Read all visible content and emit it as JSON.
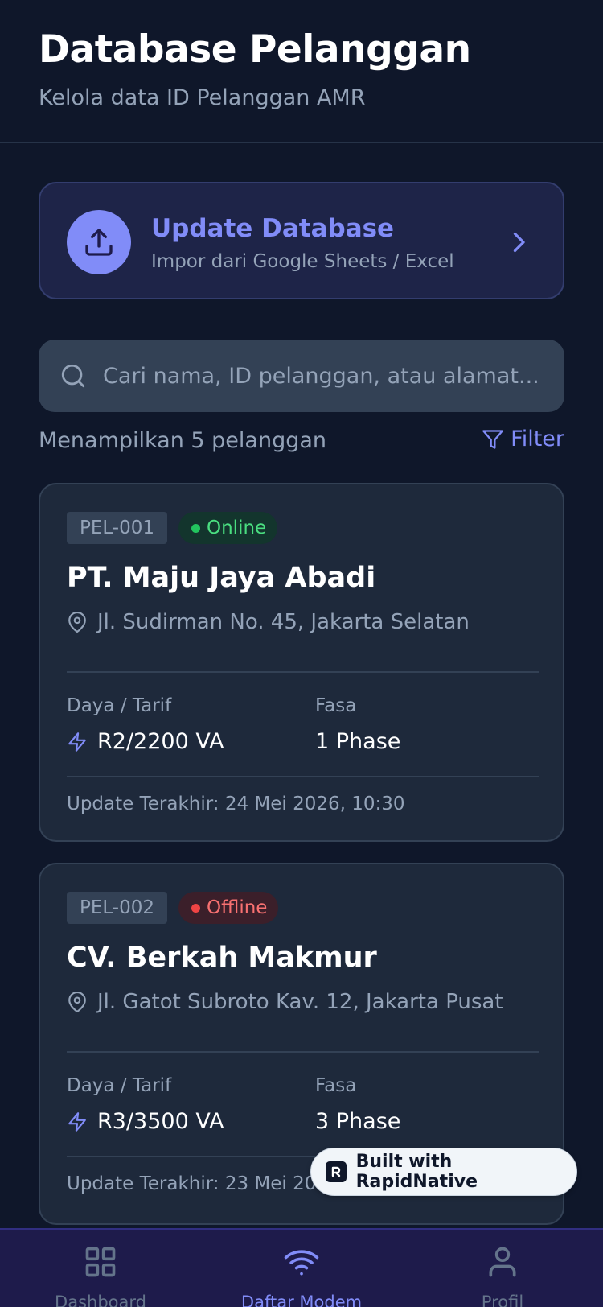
{
  "header": {
    "title": "Database Pelanggan",
    "subtitle": "Kelola data ID Pelanggan AMR"
  },
  "update_card": {
    "icon": "upload-icon",
    "title": "Update Database",
    "description": "Impor dari Google Sheets / Excel"
  },
  "search": {
    "placeholder": "Cari nama, ID pelanggan, atau alamat...",
    "value": ""
  },
  "results": {
    "summary": "Menampilkan 5 pelanggan",
    "filter_label": "Filter"
  },
  "customers": [
    {
      "id": "PEL-001",
      "status": "Online",
      "name": "PT. Maju Jaya Abadi",
      "address": "Jl. Sudirman No. 45, Jakarta Selatan",
      "power_label": "Daya / Tarif",
      "power_value": "R2/2200 VA",
      "phase_label": "Fasa",
      "phase_value": "1 Phase",
      "last_update": "Update Terakhir: 24 Mei 2026, 10:30"
    },
    {
      "id": "PEL-002",
      "status": "Offline",
      "name": "CV. Berkah Makmur",
      "address": "Jl. Gatot Subroto Kav. 12, Jakarta Pusat",
      "power_label": "Daya / Tarif",
      "power_value": "R3/3500 VA",
      "phase_label": "Fasa",
      "phase_value": "3 Phase",
      "last_update": "Update Terakhir: 23 Mei 2026"
    }
  ],
  "badge": {
    "text": "Built with RapidNative"
  },
  "nav": [
    {
      "label": "Dashboard",
      "icon": "grid-icon",
      "active": false
    },
    {
      "label": "Daftar Modem",
      "icon": "wifi-icon",
      "active": true
    },
    {
      "label": "Profil",
      "icon": "user-icon",
      "active": false
    }
  ],
  "colors": {
    "background": "#0f172a",
    "card": "#1e293b",
    "accent": "#818cf8",
    "online": "#22c55e",
    "offline": "#ef4444",
    "nav_background": "#1e1b4b"
  }
}
